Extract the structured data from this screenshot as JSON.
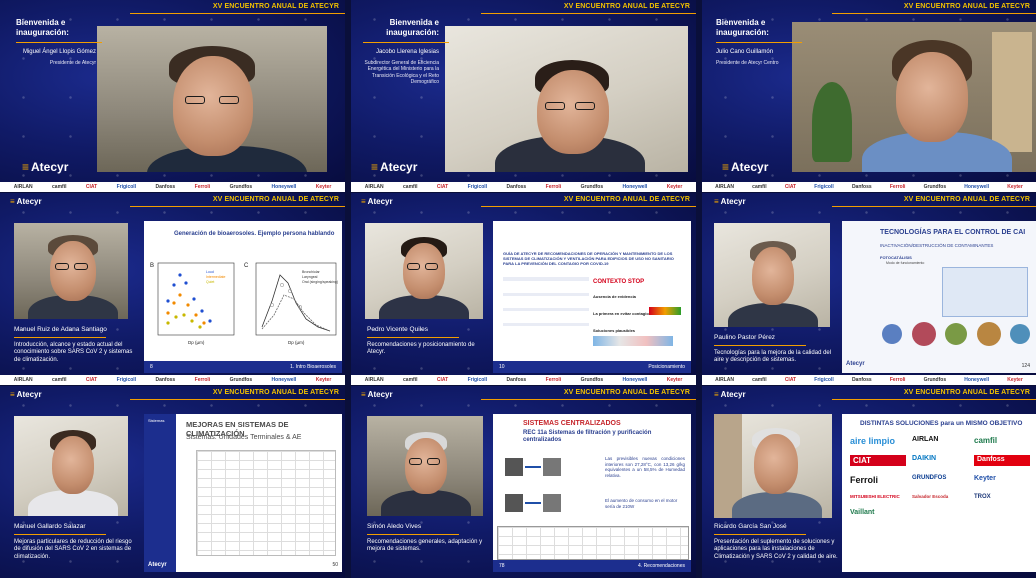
{
  "event_header": "XV ENCUENTRO ANUAL DE ATECYR",
  "brand": "Atecyr",
  "sponsors": [
    "AIRLAN",
    "camfil",
    "CIAT",
    "Frigicoll",
    "Danfoss",
    "Ferroli",
    "Grundfos",
    "Honeywell",
    "Keyter",
    "Mitsubishi",
    "Salvador Escoda",
    "Trox",
    "Vaillant"
  ],
  "tiles": [
    {
      "type": "welcome",
      "heading": "Bienvenida e inauguración:",
      "speaker": "Miguel Ángel Llopis Gómez",
      "role": "Presidente de Atecyr"
    },
    {
      "type": "welcome",
      "heading": "Bienvenida e inauguración:",
      "speaker": "Jacobo Llerena Iglesias",
      "role": "Subdirector General de Eficiencia Energética del Ministerio para la Transición Ecológica y el Reto Demográfico"
    },
    {
      "type": "welcome",
      "heading": "Bienvenida e inauguración:",
      "speaker": "Julio Cano Guillamón",
      "role": "Presidente de Atecyr Centro"
    },
    {
      "type": "talk",
      "speaker": "Manuel Ruiz de Adana Santiago",
      "topic": "Introducción, alcance y estado actual del conocimiento sobre SARS CoV 2 y sistemas de climatización.",
      "slide_title": "Generación de bioaerosoles. Ejemplo persona hablando",
      "slide_footer": "1. Intro Bioaerosoles",
      "slide_page": "8",
      "chart_legend_left": [
        "Loud",
        "Intermediate",
        "Quiet"
      ],
      "chart_legend_right": [
        "Bronchiolar",
        "Laryngeal",
        "Oral (singing/speaking)"
      ],
      "xlabel_left": "Dp (µm)",
      "xlabel_right": "Dp (µm)",
      "panel_a": "B",
      "panel_b": "C"
    },
    {
      "type": "talk",
      "speaker": "Pedro Vicente Quiles",
      "topic": "Recomendaciones y posicionamiento de Atecyr.",
      "slide_title": "GUÍA DE ATECYR DE RECOMENDACIONES DE OPERACIÓN Y MANTENIMIENTO DE LOS SISTEMAS DE CLIMATIZACIÓN Y VENTILACIÓN PARA EDIFICIOS DE USO NO SANITARIO PARA LA PREVENCIÓN DEL CONTAGIO POR COVID-19",
      "slide_sub": "CONTEXTO STOP",
      "slide_items": [
        "Ausencia de evidencia",
        "La primera en evitar contagios",
        "Soluciones plausibles"
      ],
      "slide_footer": "Posicionamiento",
      "slide_page": "10"
    },
    {
      "type": "talk",
      "speaker": "Paulino Pastor Pérez",
      "topic": "Tecnologías para la mejora de la calidad del aire y descripción de sistemas.",
      "slide_title": "TECNOLOGÍAS PARA EL CONTROL DE CAI",
      "slide_sub": "INACTIVACIÓN/DESTRUCCIÓN DE CONTAMINANTES",
      "slide_items": [
        "FOTOCATÁLISIS",
        "Modo de funcionamiento"
      ],
      "slide_page": "124"
    },
    {
      "type": "talk",
      "speaker": "Manuel Gallardo Salazar",
      "topic": "Mejoras particulares de reducción del riesgo de difusión del SARS CoV 2 en sistemas de climatización.",
      "slide_title": "MEJORAS EN SISTEMAS DE CLIMATIZACIÓN",
      "slide_sub": "Sistemas: Unidades Terminales & AE",
      "slide_side": "Sistemas",
      "slide_page": "50"
    },
    {
      "type": "talk",
      "speaker": "Simón Aledo Vives",
      "topic": "Recomendaciones generales, adaptación y mejora de sistemas.",
      "slide_title": "SISTEMAS CENTRALIZADOS",
      "slide_sub": "REC 11a Sistemas de filtración y purificación centralizados",
      "slide_text": "Las previsibles nuevas condiciones interiores son 27,28°C, con 13,26 g/kg equivalentes a un 58,5% de Humedad relativa.",
      "slide_text2": "El aumento de consumo en el motor sería de 210W",
      "slide_footer": "4. Recomendaciones",
      "slide_page": "78"
    },
    {
      "type": "talk",
      "speaker": "Ricardo García San José",
      "topic": "Presentación del suplemento de soluciones y aplicaciones para las instalaciones de Climatización y SARS CoV 2 y calidad de aire.",
      "slide_title": "DISTINTAS SOLUCIONES para un MISMO OBJETIVO",
      "slide_logos": [
        "aire limpio",
        "AIRLAN",
        "camfil",
        "CIAT",
        "DAIKIN",
        "Danfoss",
        "Ferroli",
        "GRUNDFOS",
        "Keyter",
        "MITSUBISHI ELECTRIC",
        "Salvador Escoda",
        "TROX",
        "Vaillant"
      ]
    }
  ]
}
